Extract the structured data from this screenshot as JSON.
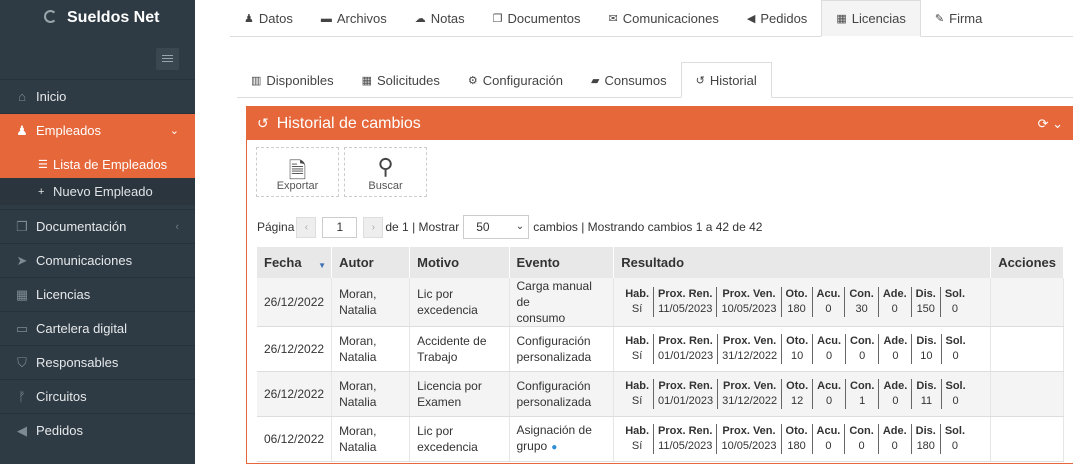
{
  "app": {
    "brand": "Sueldos Net"
  },
  "sidebar": {
    "items": [
      {
        "label": "Inicio",
        "icon": "home-icon"
      },
      {
        "label": "Empleados",
        "icon": "users-icon",
        "active": true
      },
      {
        "label": "Documentación",
        "icon": "document-icon"
      },
      {
        "label": "Comunicaciones",
        "icon": "send-icon"
      },
      {
        "label": "Licencias",
        "icon": "calendar-icon"
      },
      {
        "label": "Cartelera digital",
        "icon": "board-icon"
      },
      {
        "label": "Responsables",
        "icon": "shield-icon"
      },
      {
        "label": "Circuitos",
        "icon": "flow-icon"
      },
      {
        "label": "Pedidos",
        "icon": "bullhorn-icon"
      }
    ],
    "subitems": [
      {
        "label": "Lista de Empleados",
        "icon": "list-icon",
        "active": true
      },
      {
        "label": "Nuevo Empleado",
        "icon": "plus-icon"
      }
    ]
  },
  "top_tabs": [
    "Datos",
    "Archivos",
    "Notas",
    "Documentos",
    "Comunicaciones",
    "Pedidos",
    "Licencias",
    "Firma"
  ],
  "inner_tabs": [
    "Disponibles",
    "Solicitudes",
    "Configuración",
    "Consumos",
    "Historial"
  ],
  "panel": {
    "title": "Historial de cambios",
    "export_label": "Exportar",
    "search_label": "Buscar"
  },
  "pager": {
    "page_label": "Página",
    "page_value": "1",
    "of_text": "de 1 | Mostrar",
    "per_page": "50",
    "summary": "cambios | Mostrando cambios 1 a 42 de 42"
  },
  "table": {
    "headers": [
      "Fecha",
      "Autor",
      "Motivo",
      "Evento",
      "Resultado",
      "Acciones"
    ],
    "result_headers": [
      "Hab.",
      "Prox. Ren.",
      "Prox. Ven.",
      "Oto.",
      "Acu.",
      "Con.",
      "Ade.",
      "Dis.",
      "Sol."
    ],
    "rows": [
      {
        "fecha": "26/12/2022",
        "autor": [
          "Moran,",
          "Natalia"
        ],
        "motivo": [
          "Lic por",
          "excedencia"
        ],
        "evento": [
          "Carga manual de",
          "consumo"
        ],
        "chat": false,
        "res": [
          "Sí",
          "11/05/2023",
          "10/05/2023",
          "180",
          "0",
          "30",
          "0",
          "150",
          "0"
        ]
      },
      {
        "fecha": "26/12/2022",
        "autor": [
          "Moran,",
          "Natalia"
        ],
        "motivo": [
          "Accidente de",
          "Trabajo"
        ],
        "evento": [
          "Configuración",
          "personalizada"
        ],
        "chat": false,
        "res": [
          "Sí",
          "01/01/2023",
          "31/12/2022",
          "10",
          "0",
          "0",
          "0",
          "10",
          "0"
        ]
      },
      {
        "fecha": "26/12/2022",
        "autor": [
          "Moran,",
          "Natalia"
        ],
        "motivo": [
          "Licencia por",
          "Examen"
        ],
        "evento": [
          "Configuración",
          "personalizada"
        ],
        "chat": false,
        "res": [
          "Sí",
          "01/01/2023",
          "31/12/2022",
          "12",
          "0",
          "1",
          "0",
          "11",
          "0"
        ]
      },
      {
        "fecha": "06/12/2022",
        "autor": [
          "Moran,",
          "Natalia"
        ],
        "motivo": [
          "Lic por",
          "excedencia"
        ],
        "evento": [
          "Asignación de",
          "grupo"
        ],
        "chat": true,
        "res": [
          "Sí",
          "11/05/2023",
          "10/05/2023",
          "180",
          "0",
          "0",
          "0",
          "180",
          "0"
        ]
      }
    ]
  },
  "colors": {
    "accent": "#e5673a",
    "sidebar": "#2f3b44"
  }
}
